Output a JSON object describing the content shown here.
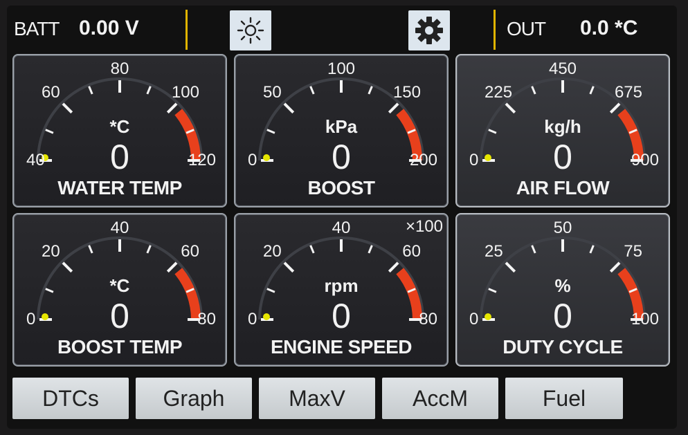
{
  "topbar": {
    "batt_label": "BATT",
    "batt_value": "0.00 V",
    "out_label": "OUT",
    "out_value": "0.0 *C",
    "accent": "#e0b400",
    "brightness_icon": "sun-icon",
    "settings_icon": "gear-icon"
  },
  "gauges": [
    {
      "name": "WATER TEMP",
      "unit": "*C",
      "value": "0",
      "min": "40",
      "max": "120",
      "labels": [
        "40",
        "60",
        "80",
        "100",
        "120"
      ],
      "multiplier": ""
    },
    {
      "name": "BOOST",
      "unit": "kPa",
      "value": "0",
      "min": "0",
      "max": "200",
      "labels": [
        "0",
        "50",
        "100",
        "150",
        "200"
      ],
      "multiplier": ""
    },
    {
      "name": "AIR FLOW",
      "unit": "kg/h",
      "value": "0",
      "min": "0",
      "max": "900",
      "labels": [
        "0",
        "225",
        "450",
        "675",
        "900"
      ],
      "multiplier": ""
    },
    {
      "name": "BOOST TEMP",
      "unit": "*C",
      "value": "0",
      "min": "0",
      "max": "80",
      "labels": [
        "0",
        "20",
        "40",
        "60",
        "80"
      ],
      "multiplier": ""
    },
    {
      "name": "ENGINE SPEED",
      "unit": "rpm",
      "value": "0",
      "min": "0",
      "max": "80",
      "labels": [
        "0",
        "20",
        "40",
        "60",
        "80"
      ],
      "multiplier": "×100"
    },
    {
      "name": "DUTY CYCLE",
      "unit": "%",
      "value": "0",
      "min": "0",
      "max": "100",
      "labels": [
        "0",
        "25",
        "50",
        "75",
        "100"
      ],
      "multiplier": ""
    }
  ],
  "buttons": [
    "DTCs",
    "Graph",
    "MaxV",
    "AccM",
    "Fuel"
  ],
  "colors": {
    "redzone": "#e8401c",
    "needle": "#e6e600"
  }
}
